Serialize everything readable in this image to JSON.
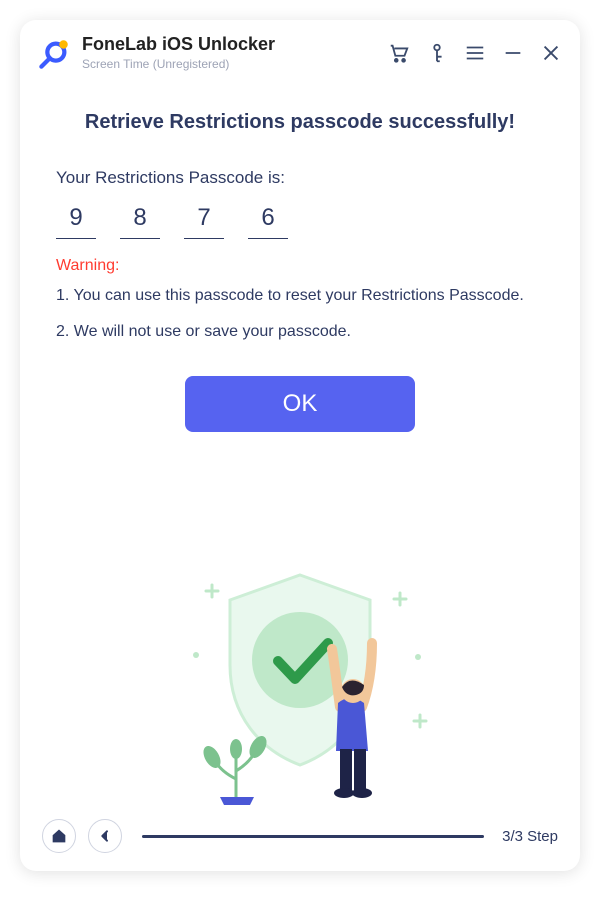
{
  "titlebar": {
    "app_title": "FoneLab iOS Unlocker",
    "subtitle": "Screen Time  (Unregistered)"
  },
  "content": {
    "heading": "Retrieve Restrictions passcode successfully!",
    "lead": "Your Restrictions Passcode is:",
    "digits": [
      "9",
      "8",
      "7",
      "6"
    ],
    "warning_label": "Warning:",
    "note1": "1. You can use this passcode to reset your Restrictions Passcode.",
    "note2": "2. We will not use or save your passcode.",
    "ok_label": "OK"
  },
  "footer": {
    "step_label": "3/3 Step"
  }
}
